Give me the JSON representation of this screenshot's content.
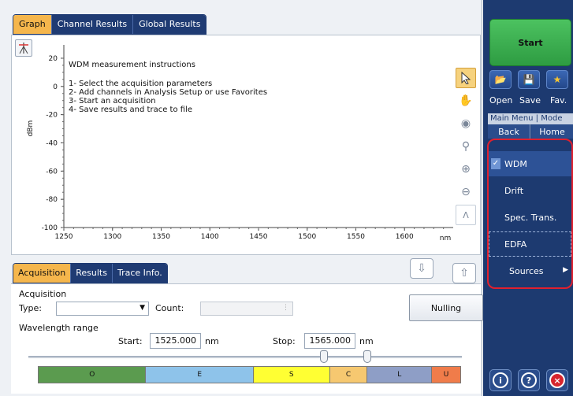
{
  "top_tabs": {
    "graph": "Graph",
    "channel_results": "Channel Results",
    "global_results": "Global Results"
  },
  "graph": {
    "instructions_title": "WDM measurement instructions",
    "instructions": [
      "1- Select the acquisition parameters",
      "2- Add channels in Analysis Setup or use Favorites",
      "3- Start an acquisition",
      "4- Save results and trace to file"
    ]
  },
  "chart_data": {
    "type": "line",
    "xlabel": "nm",
    "ylabel": "dBm",
    "xlim": [
      1250,
      1650
    ],
    "ylim": [
      -100,
      25
    ],
    "x_ticks": [
      "1250",
      "1300",
      "1350",
      "1400",
      "1450",
      "1500",
      "1550",
      "1600"
    ],
    "y_ticks": [
      "20",
      "0",
      "-20",
      "-40",
      "-60",
      "-80",
      "-100"
    ],
    "series": [],
    "grid": false
  },
  "bottom_tabs": {
    "acquisition": "Acquisition",
    "results": "Results",
    "trace_info": "Trace Info."
  },
  "acquisition": {
    "section_label": "Acquisition",
    "type_label": "Type:",
    "type_value": "",
    "count_label": "Count:",
    "count_value": "",
    "nulling_label": "Nulling",
    "wavelength_label": "Wavelength range",
    "start_label": "Start:",
    "start_value": "1525.000",
    "start_unit": "nm",
    "stop_label": "Stop:",
    "stop_value": "1565.000",
    "stop_unit": "nm"
  },
  "bands": [
    {
      "label": "O",
      "color": "#5b9b4f"
    },
    {
      "label": "E",
      "color": "#8ec3ea"
    },
    {
      "label": "S",
      "color": "#ffff33"
    },
    {
      "label": "C",
      "color": "#f6c870"
    },
    {
      "label": "L",
      "color": "#8e9ec6"
    },
    {
      "label": "U",
      "color": "#f07c4a"
    }
  ],
  "right_panel": {
    "start": "Start",
    "open": "Open",
    "save": "Save",
    "fav": "Fav.",
    "main_menu": "Main Menu | Mode",
    "back": "Back",
    "home": "Home",
    "menu": {
      "wdm": "WDM",
      "drift": "Drift",
      "spec_trans": "Spec. Trans.",
      "edfa": "EDFA",
      "sources": "Sources"
    },
    "accent_red": "#e0202e",
    "start_green": "#3aae4f"
  }
}
